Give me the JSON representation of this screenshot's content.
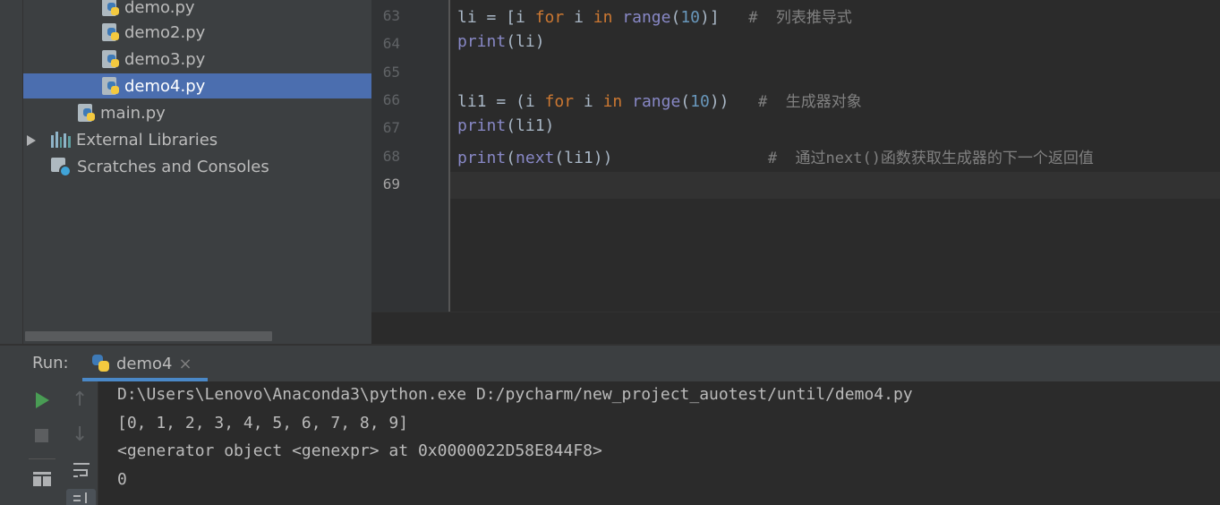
{
  "project_tree": {
    "items": [
      {
        "label": "demo.py",
        "kind": "python-file",
        "selected": false
      },
      {
        "label": "demo2.py",
        "kind": "python-file",
        "selected": false
      },
      {
        "label": "demo3.py",
        "kind": "python-file",
        "selected": false
      },
      {
        "label": "demo4.py",
        "kind": "python-file",
        "selected": true
      },
      {
        "label": "main.py",
        "kind": "python-file",
        "selected": false
      },
      {
        "label": "External Libraries",
        "kind": "library",
        "selected": false
      },
      {
        "label": "Scratches and Consoles",
        "kind": "scratch",
        "selected": false
      }
    ]
  },
  "editor": {
    "current_line": "69",
    "lines": [
      {
        "number": "63",
        "tokens": [
          [
            "plain",
            "li = ["
          ],
          [
            "plain",
            "i "
          ],
          [
            "kw",
            "for"
          ],
          [
            "plain",
            " i "
          ],
          [
            "kw",
            "in"
          ],
          [
            "plain",
            " "
          ],
          [
            "bi",
            "range"
          ],
          [
            "plain",
            "("
          ],
          [
            "num",
            "10"
          ],
          [
            "plain",
            ")]   "
          ],
          [
            "cm",
            "#  列表推导式"
          ]
        ]
      },
      {
        "number": "64",
        "tokens": [
          [
            "bi",
            "print"
          ],
          [
            "plain",
            "(li)"
          ]
        ]
      },
      {
        "number": "65",
        "tokens": []
      },
      {
        "number": "66",
        "tokens": [
          [
            "plain",
            "li1 = (i "
          ],
          [
            "kw",
            "for"
          ],
          [
            "plain",
            " i "
          ],
          [
            "kw",
            "in"
          ],
          [
            "plain",
            " "
          ],
          [
            "bi",
            "range"
          ],
          [
            "plain",
            "("
          ],
          [
            "num",
            "10"
          ],
          [
            "plain",
            "))   "
          ],
          [
            "cm",
            "#  生成器对象"
          ]
        ]
      },
      {
        "number": "67",
        "tokens": [
          [
            "bi",
            "print"
          ],
          [
            "plain",
            "(li1)"
          ]
        ]
      },
      {
        "number": "68",
        "tokens": [
          [
            "bi",
            "print"
          ],
          [
            "plain",
            "("
          ],
          [
            "bi",
            "next"
          ],
          [
            "plain",
            "(li1))                "
          ],
          [
            "cm",
            "#  通过next()函数获取生成器的下一个返回值"
          ]
        ]
      },
      {
        "number": "69",
        "tokens": []
      }
    ]
  },
  "run_panel": {
    "label": "Run:",
    "tab_label": "demo4",
    "close_glyph": "×",
    "up_glyph": "↑",
    "down_glyph": "↓",
    "console": [
      "D:\\Users\\Lenovo\\Anaconda3\\python.exe D:/pycharm/new_project_auotest/until/demo4.py",
      "[0, 1, 2, 3, 4, 5, 6, 7, 8, 9]",
      "<generator object <genexpr> at 0x0000022D58E844F8>",
      "0"
    ]
  },
  "colors": {
    "selection": "#4b6eaf",
    "keyword": "#cc7832",
    "builtin": "#8888c6",
    "number": "#6897bb",
    "comment": "#808080",
    "run_green": "#499c54"
  }
}
